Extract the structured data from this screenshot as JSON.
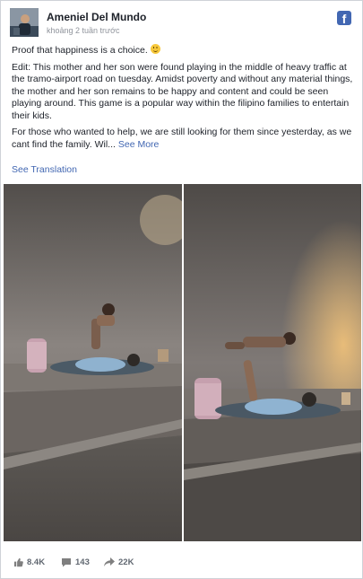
{
  "post": {
    "author": "Ameniel Del Mundo",
    "timestamp": "khoảng 2 tuần trước",
    "paragraph_1": "Proof that happiness is a choice.",
    "paragraph_2": "Edit: This mother and her son were found playing in the middle of heavy traffic at the tramo-airport road on tuesday. Amidst poverty and without any material things, the mother and her son remains to be happy and content and could be seen playing around. This game is a popular way within the filipino families to entertain their kids.",
    "paragraph_3": "For those who wanted to help, we are still looking for them since yesterday, as we cant find the family. Wil...",
    "see_more": "See More",
    "see_translation": "See Translation"
  },
  "stats": {
    "likes": "8.4K",
    "comments": "143",
    "shares": "22K"
  },
  "icons": {
    "brand": "facebook-icon",
    "emoji": "smiley-emoji",
    "likes": "thumbs-up-icon",
    "comments": "comment-icon",
    "shares": "share-arrow-icon"
  },
  "colors": {
    "brand_blue": "#4267b2",
    "text": "#1d2129",
    "muted": "#90949c",
    "stat_gray": "#606770"
  }
}
